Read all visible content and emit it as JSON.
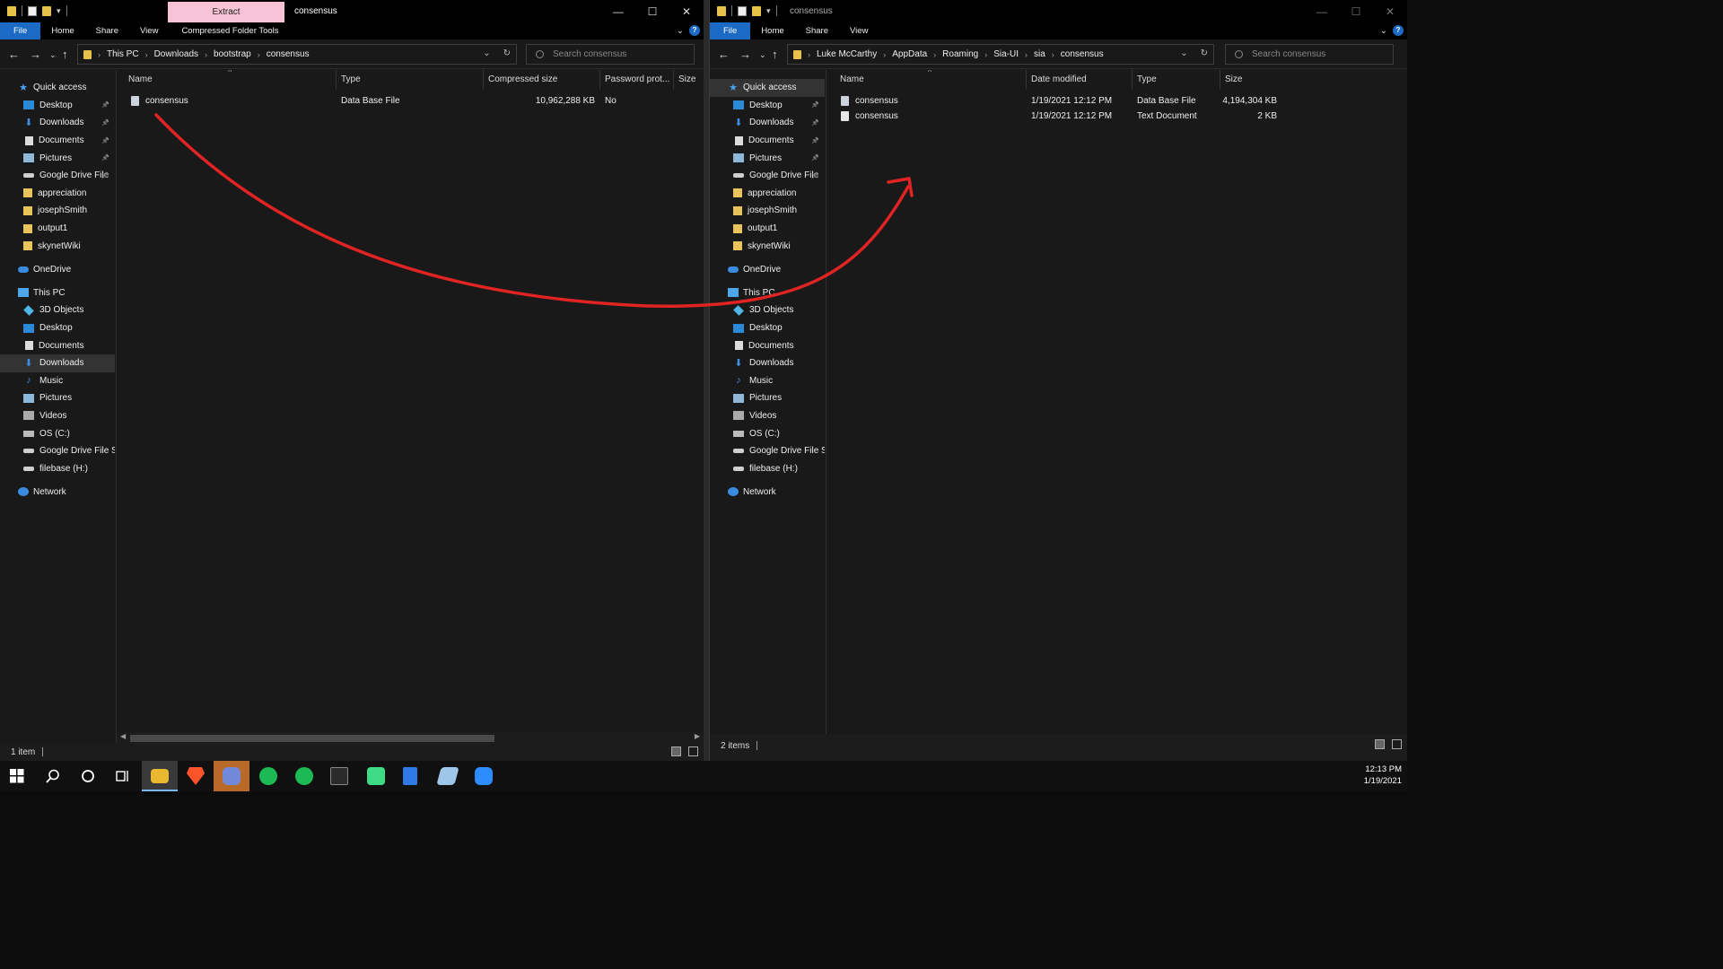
{
  "left": {
    "title": "consensus",
    "contextual_tab": "Extract",
    "ribbon_tabs": [
      "File",
      "Home",
      "Share",
      "View",
      "Compressed Folder Tools"
    ],
    "breadcrumb": [
      "This PC",
      "Downloads",
      "bootstrap",
      "consensus"
    ],
    "search_placeholder": "Search consensus",
    "columns": [
      "Name",
      "Type",
      "Compressed size",
      "Password prot...",
      "Size"
    ],
    "rows": [
      {
        "name": "consensus",
        "type": "Data Base File",
        "compressed_size": "10,962,288 KB",
        "password": "No",
        "size": ""
      }
    ],
    "status_text": "1 item"
  },
  "right": {
    "title": "consensus",
    "ribbon_tabs": [
      "File",
      "Home",
      "Share",
      "View"
    ],
    "breadcrumb": [
      "Luke McCarthy",
      "AppData",
      "Roaming",
      "Sia-UI",
      "sia",
      "consensus"
    ],
    "search_placeholder": "Search consensus",
    "columns": [
      "Name",
      "Date modified",
      "Type",
      "Size"
    ],
    "rows": [
      {
        "name": "consensus",
        "date": "1/19/2021 12:12 PM",
        "type": "Data Base File",
        "size": "4,194,304 KB"
      },
      {
        "name": "consensus",
        "date": "1/19/2021 12:12 PM",
        "type": "Text Document",
        "size": "2 KB"
      }
    ],
    "status_text": "2 items"
  },
  "sidebar": {
    "quick_access": "Quick access",
    "quick_items": [
      {
        "label": "Desktop",
        "icon": "desktop-icon",
        "pinned": true
      },
      {
        "label": "Downloads",
        "icon": "download-icon",
        "pinned": true
      },
      {
        "label": "Documents",
        "icon": "document-icon",
        "pinned": true
      },
      {
        "label": "Pictures",
        "icon": "pictures-icon",
        "pinned": true
      },
      {
        "label": "Google Drive File",
        "icon": "drive-icon",
        "pinned": true
      },
      {
        "label": "appreciation",
        "icon": "folder-icon",
        "pinned": false
      },
      {
        "label": "josephSmith",
        "icon": "folder-icon",
        "pinned": false
      },
      {
        "label": "output1",
        "icon": "folder-icon",
        "pinned": false
      },
      {
        "label": "skynetWiki",
        "icon": "folder-icon",
        "pinned": false
      }
    ],
    "onedrive": "OneDrive",
    "this_pc": "This PC",
    "pc_items": [
      {
        "label": "3D Objects",
        "icon": "3d-objects-icon"
      },
      {
        "label": "Desktop",
        "icon": "desktop-icon"
      },
      {
        "label": "Documents",
        "icon": "document-icon"
      },
      {
        "label": "Downloads",
        "icon": "download-icon"
      },
      {
        "label": "Music",
        "icon": "music-icon"
      },
      {
        "label": "Pictures",
        "icon": "pictures-icon"
      },
      {
        "label": "Videos",
        "icon": "videos-icon"
      },
      {
        "label": "OS (C:)",
        "icon": "os-drive-icon"
      },
      {
        "label": "Google Drive File St",
        "icon": "drive-icon"
      },
      {
        "label": "filebase (H:)",
        "icon": "drive-icon"
      }
    ],
    "network": "Network"
  },
  "taskbar": {
    "time": "12:13 PM",
    "date": "1/19/2021",
    "apps": [
      "windows-start-icon",
      "search-icon",
      "cortana-icon",
      "task-view-icon",
      "file-explorer-icon",
      "brave-icon",
      "discord-icon",
      "spotify-icon",
      "spotify-icon",
      "terminal-icon",
      "android-studio-icon",
      "notepad-icon",
      "app-icon",
      "zoom-icon"
    ]
  },
  "colors": {
    "accent": "#1b6ac5",
    "annotation_arrow": "#e02323",
    "contextual_tab": "#f9c3d7"
  }
}
